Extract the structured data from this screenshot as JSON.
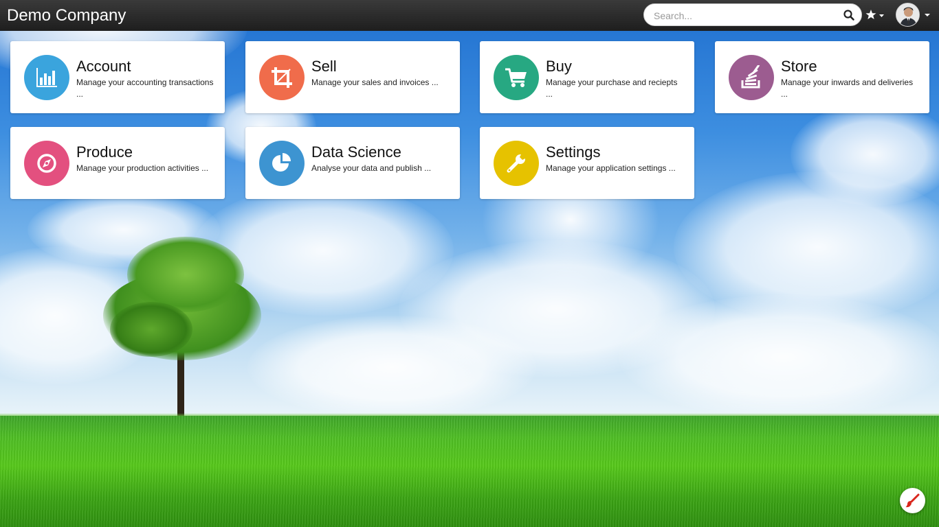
{
  "header": {
    "brand": "Demo Company",
    "search_placeholder": "Search...",
    "user": "user-avatar"
  },
  "apps": [
    {
      "title": "Account",
      "description": "Manage your accounting transactions ...",
      "icon": "bar-chart-icon",
      "color": "#3aa4dd"
    },
    {
      "title": "Sell",
      "description": "Manage your sales and invoices ...",
      "icon": "crop-icon",
      "color": "#f06c4b"
    },
    {
      "title": "Buy",
      "description": "Manage your purchase and reciepts ...",
      "icon": "shopping-cart-icon",
      "color": "#27a882"
    },
    {
      "title": "Store",
      "description": "Manage your inwards and deliveries ...",
      "icon": "stack-icon",
      "color": "#9c5c90"
    },
    {
      "title": "Produce",
      "description": "Manage your production activities ...",
      "icon": "compass-icon",
      "color": "#e3507f"
    },
    {
      "title": "Data Science",
      "description": "Analyse your data and publish ...",
      "icon": "pie-chart-icon",
      "color": "#3d94d1"
    },
    {
      "title": "Settings",
      "description": "Manage your application settings ...",
      "icon": "wrench-icon",
      "color": "#e6c200"
    }
  ],
  "fab": {
    "icon": "paint-brush-icon"
  }
}
